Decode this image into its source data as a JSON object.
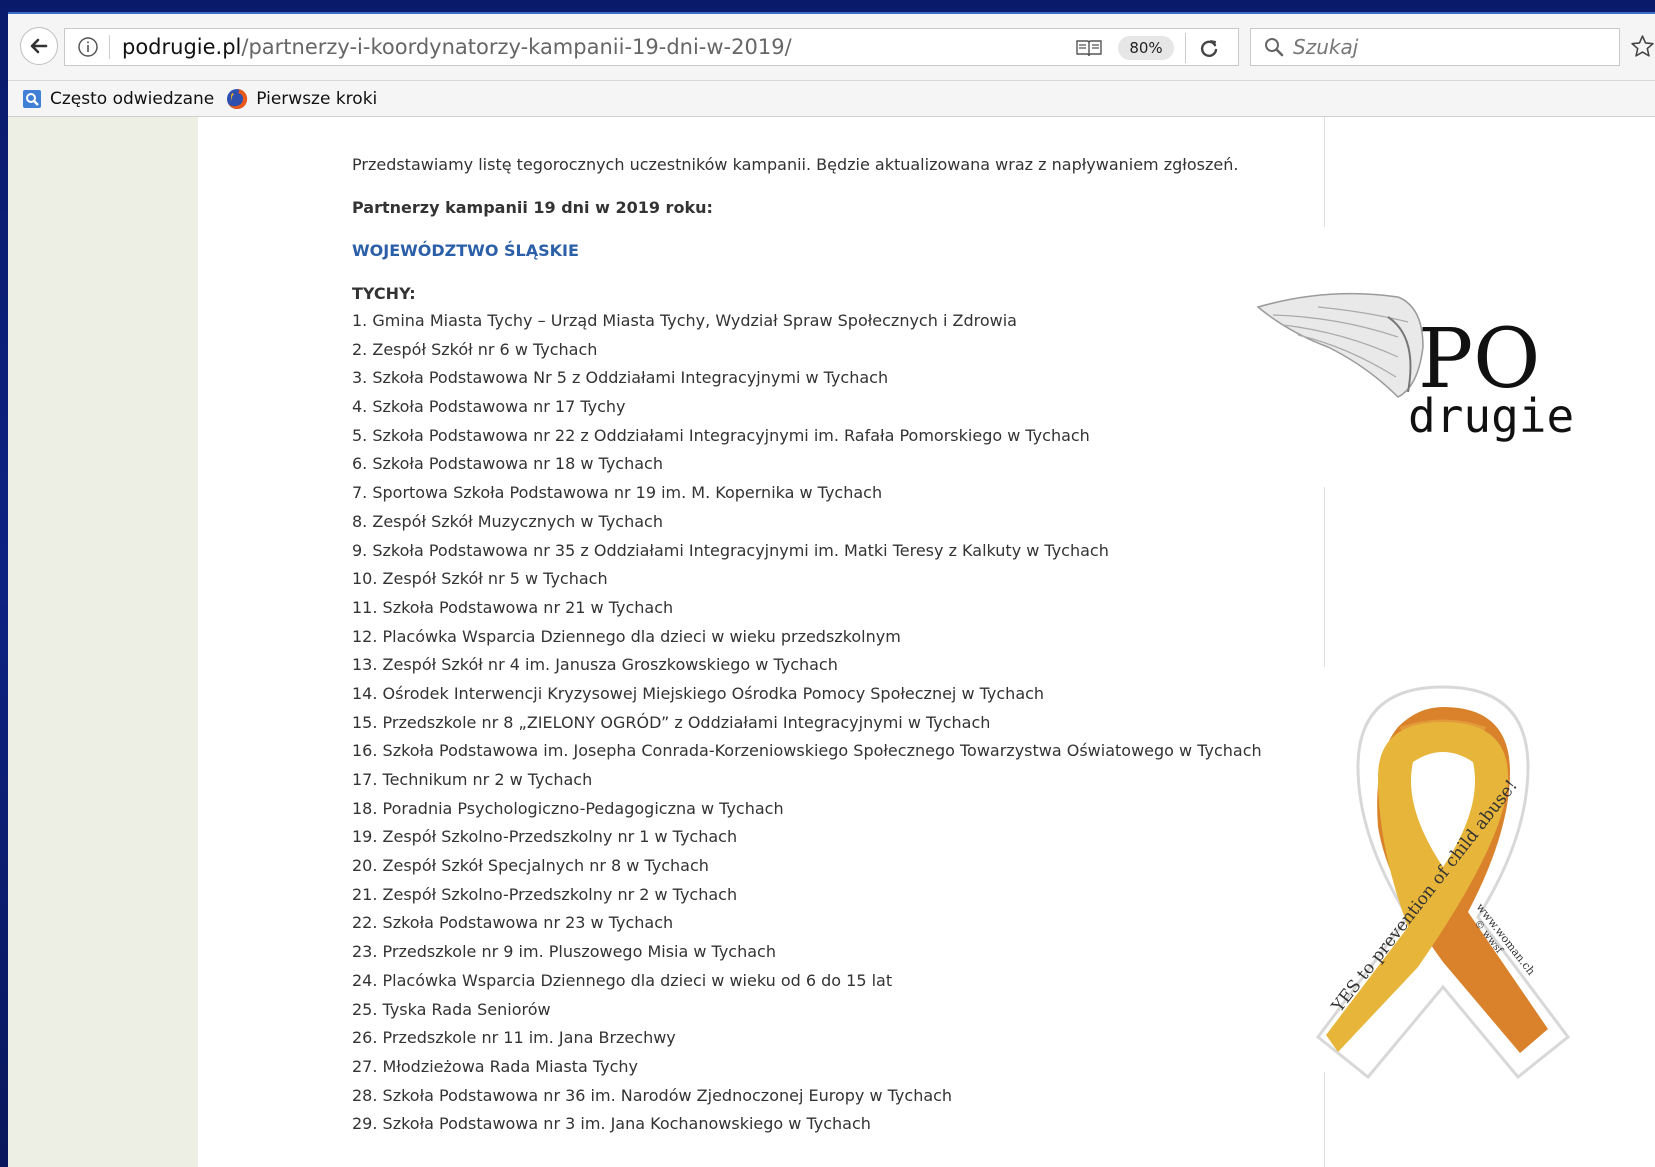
{
  "browser": {
    "url_host": "podrugie.pl",
    "url_path": "/partnerzy-i-koordynatorzy-kampanii-19-dni-w-2019/",
    "zoom": "80%",
    "search_placeholder": "Szukaj"
  },
  "bookmarks": [
    {
      "label": "Często odwiedzane",
      "icon": "frequent-icon"
    },
    {
      "label": "Pierwsze kroki",
      "icon": "firefox-icon"
    }
  ],
  "content": {
    "intro": "Przedstawiamy listę tegorocznych uczestników kampanii. Będzie aktualizowana wraz z napływaniem zgłoszeń.",
    "partners_heading": "Partnerzy kampanii 19 dni w 2019 roku:",
    "region": "WOJEWÓDZTWO ŚLĄSKIE",
    "city": "TYCHY:",
    "items": [
      "1. Gmina Miasta Tychy – Urząd Miasta Tychy, Wydział Spraw Społecznych i Zdrowia",
      "2. Zespół Szkół nr 6 w Tychach",
      "3. Szkoła Podstawowa Nr 5 z Oddziałami Integracyjnymi w Tychach",
      "4. Szkoła Podstawowa nr 17 Tychy",
      "5. Szkoła Podstawowa nr 22 z Oddziałami Integracyjnymi im. Rafała Pomorskiego w Tychach",
      "6. Szkoła Podstawowa nr 18 w Tychach",
      "7. Sportowa Szkoła Podstawowa nr 19 im. M. Kopernika w Tychach",
      "8. Zespół Szkół Muzycznych w Tychach",
      "9. Szkoła Podstawowa nr 35 z Oddziałami Integracyjnymi im. Matki Teresy z Kalkuty w Tychach",
      "10. Zespół Szkół nr 5 w Tychach",
      "11. Szkoła Podstawowa nr 21 w Tychach",
      "12. Placówka Wsparcia Dziennego dla dzieci w wieku przedszkolnym",
      "13. Zespół Szkół nr 4 im. Janusza Groszkowskiego w Tychach",
      "14. Ośrodek Interwencji Kryzysowej Miejskiego Ośrodka Pomocy Społecznej w Tychach",
      "15. Przedszkole nr 8 „ZIELONY OGRÓD” z Oddziałami Integracyjnymi w Tychach",
      "16. Szkoła Podstawowa im. Josepha Conrada-Korzeniowskiego Społecznego Towarzystwa Oświatowego w Tychach",
      "17. Technikum nr 2 w Tychach",
      "18. Poradnia Psychologiczno-Pedagogiczna w Tychach",
      "19. Zespół Szkolno-Przedszkolny nr 1 w Tychach",
      "20. Zespół Szkół Specjalnych nr 8 w Tychach",
      "21.  Zespół Szkolno-Przedszkolny nr 2 w Tychach",
      "22. Szkoła Podstawowa nr 23 w Tychach",
      "23. Przedszkole nr 9 im. Pluszowego Misia w Tychach",
      "24. Placówka Wsparcia Dziennego dla dzieci w wieku od 6 do 15 lat",
      "25. Tyska Rada Seniorów",
      "26. Przedszkole nr 11 im. Jana Brzechwy",
      "27. Młodzieżowa Rada Miasta Tychy",
      "28. Szkoła Podstawowa nr 36 im. Narodów Zjednoczonej Europy w Tychach",
      "29. Szkoła Podstawowa nr 3 im. Jana Kochanowskiego w Tychach"
    ]
  },
  "sidebar": {
    "logo_text_top": "PO",
    "logo_text_bottom": "drugie",
    "ribbon_main": "YES to prevention of child abuse!",
    "ribbon_small_1": "www.woman.ch",
    "ribbon_small_2": "© wwsf"
  },
  "colors": {
    "region_link": "#2b5fa8",
    "left_gutter": "#edeee4",
    "ribbon_yellow": "#e7b53a",
    "ribbon_orange": "#d9822b"
  }
}
